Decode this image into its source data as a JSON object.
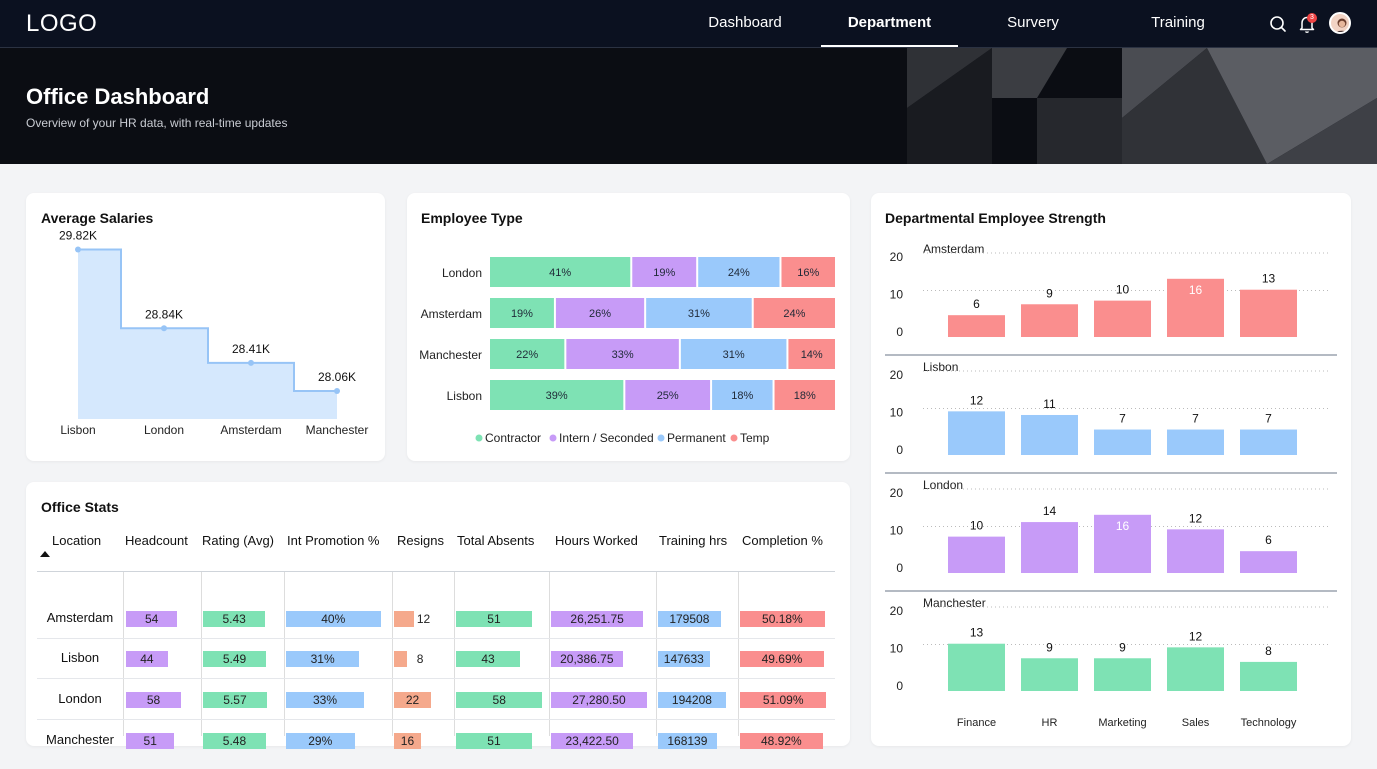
{
  "nav": {
    "logo": "LOGO",
    "items": [
      "Dashboard",
      "Department",
      "Survery",
      "Training"
    ],
    "active": "Department",
    "notification_count": "3",
    "icons": [
      "search-icon",
      "bell-icon",
      "avatar"
    ]
  },
  "hero": {
    "title": "Office Dashboard",
    "subtitle": "Overview of your HR data, with real-time updates"
  },
  "colors": {
    "contractor": "#7ee2b4",
    "intern": "#c79bf7",
    "permanent": "#9ac9fb",
    "temp": "#fa8e8e",
    "salary_fill": "#d5e8fd",
    "salary_line": "#97c4f6",
    "resigns": "#f5a98c"
  },
  "avg_salaries": {
    "title": "Average Salaries",
    "chart_data": {
      "type": "area",
      "categories": [
        "Lisbon",
        "London",
        "Amsterdam",
        "Manchester"
      ],
      "values": [
        29.82,
        28.84,
        28.41,
        28.06
      ],
      "labels": [
        "29.82K",
        "28.84K",
        "28.41K",
        "28.06K"
      ],
      "ylim": [
        27.6,
        30.0
      ]
    }
  },
  "employee_type": {
    "title": "Employee Type",
    "chart_data": {
      "type": "bar",
      "stacked": true,
      "orientation": "horizontal",
      "categories": [
        "London",
        "Amsterdam",
        "Manchester",
        "Lisbon"
      ],
      "series": [
        {
          "name": "Contractor",
          "values": [
            41,
            19,
            22,
            39
          ]
        },
        {
          "name": "Intern / Seconded",
          "values": [
            19,
            26,
            33,
            25
          ]
        },
        {
          "name": "Permanent",
          "values": [
            24,
            31,
            31,
            18
          ]
        },
        {
          "name": "Temp",
          "values": [
            16,
            24,
            14,
            18
          ]
        }
      ],
      "legend": "bottom"
    }
  },
  "dept_strength": {
    "title": "Departmental Employee Strength",
    "chart_data": [
      {
        "type": "bar",
        "title": "Amsterdam",
        "categories": [
          "Finance",
          "HR",
          "Marketing",
          "Sales",
          "Technology"
        ],
        "values": [
          6,
          9,
          10,
          16,
          13
        ],
        "yticks": [
          "20",
          "10",
          "0"
        ],
        "ylim": [
          0,
          20
        ],
        "color": "#fa8e8e"
      },
      {
        "type": "bar",
        "title": "Lisbon",
        "categories": [
          "Finance",
          "HR",
          "Marketing",
          "Sales",
          "Technology"
        ],
        "values": [
          12,
          11,
          7,
          7,
          7
        ],
        "yticks": [
          "20",
          "10",
          "0"
        ],
        "ylim": [
          0,
          20
        ],
        "color": "#9ac9fb"
      },
      {
        "type": "bar",
        "title": "London",
        "categories": [
          "Finance",
          "HR",
          "Marketing",
          "Sales",
          "Technology"
        ],
        "values": [
          10,
          14,
          16,
          12,
          6
        ],
        "yticks": [
          "20",
          "10",
          "0"
        ],
        "ylim": [
          0,
          20
        ],
        "color": "#c79bf7"
      },
      {
        "type": "bar",
        "title": "Manchester",
        "categories": [
          "Finance",
          "HR",
          "Marketing",
          "Sales",
          "Technology"
        ],
        "values": [
          13,
          9,
          9,
          12,
          8
        ],
        "yticks": [
          "20",
          "10",
          "0"
        ],
        "ylim": [
          0,
          20
        ],
        "color": "#7ee2b4"
      }
    ]
  },
  "office_stats": {
    "title": "Office Stats",
    "sort": "ascending",
    "columns": [
      "Location",
      "Headcount",
      "Rating (Avg)",
      "Int Promotion %",
      "Resigns",
      "Total Absents",
      "Hours Worked",
      "Training hrs",
      "Completion %"
    ],
    "rows": [
      {
        "location": "Amsterdam",
        "headcount": "54",
        "rating": "5.43",
        "promotion": "40%",
        "resigns": "12",
        "absents": "51",
        "hours": "26,251.75",
        "training": "179508",
        "completion": "50.18%"
      },
      {
        "location": "Lisbon",
        "headcount": "44",
        "rating": "5.49",
        "promotion": "31%",
        "resigns": "8",
        "absents": "43",
        "hours": "20,386.75",
        "training": "147633",
        "completion": "49.69%"
      },
      {
        "location": "London",
        "headcount": "58",
        "rating": "5.57",
        "promotion": "33%",
        "resigns": "22",
        "absents": "58",
        "hours": "27,280.50",
        "training": "194208",
        "completion": "51.09%"
      },
      {
        "location": "Manchester",
        "headcount": "51",
        "rating": "5.48",
        "promotion": "29%",
        "resigns": "16",
        "absents": "51",
        "hours": "23,422.50",
        "training": "168139",
        "completion": "48.92%"
      }
    ]
  }
}
